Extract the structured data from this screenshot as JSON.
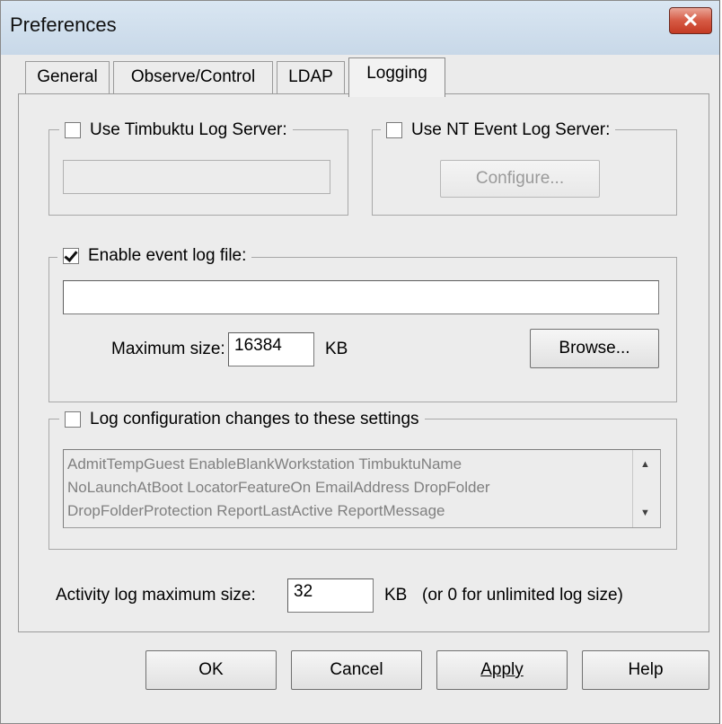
{
  "window": {
    "title": "Preferences"
  },
  "tabs": [
    {
      "label": "General"
    },
    {
      "label": "Observe/Control"
    },
    {
      "label": "LDAP"
    },
    {
      "label": "Logging"
    }
  ],
  "timbuktu_log": {
    "label": "Use Timbuktu Log Server:",
    "checked": false,
    "value": ""
  },
  "nt_event_log": {
    "label": "Use NT Event Log Server:",
    "checked": false,
    "configure_label": "Configure..."
  },
  "event_log_file": {
    "label": "Enable event log file:",
    "checked": true,
    "path_value": "",
    "max_size_label": "Maximum size:",
    "max_size_value": "16384",
    "unit": "KB",
    "browse_label": "Browse..."
  },
  "config_changes": {
    "label": "Log configuration changes to these settings",
    "checked": false,
    "list_lines": [
      "AdmitTempGuest EnableBlankWorkstation TimbuktuName",
      "NoLaunchAtBoot LocatorFeatureOn EmailAddress DropFolder",
      "DropFolderProtection ReportLastActive ReportMessage"
    ]
  },
  "activity_log": {
    "label": "Activity log maximum size:",
    "value": "32",
    "unit": "KB",
    "note": "(or 0 for unlimited log size)"
  },
  "buttons": {
    "ok": "OK",
    "cancel": "Cancel",
    "apply": "Apply",
    "help": "Help"
  },
  "icons": {
    "close": "close-icon",
    "scroll_up": "scroll-up-arrow-icon",
    "scroll_down": "scroll-down-arrow-icon"
  },
  "colors": {
    "close_button": "#d65a44",
    "titlebar": "#c8d8e8",
    "dialog_bg": "#ebebeb"
  }
}
